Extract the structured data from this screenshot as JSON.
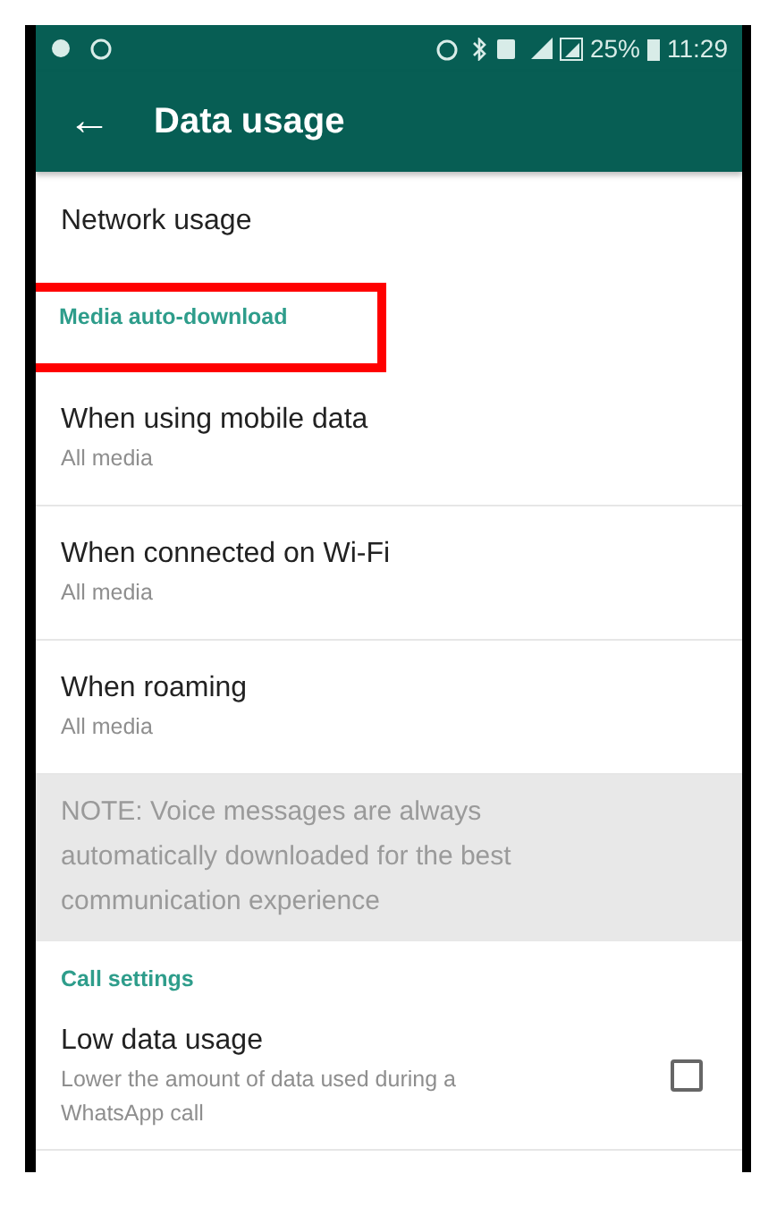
{
  "status_bar": {
    "battery": "25%",
    "time": "11:29"
  },
  "toolbar": {
    "back": "←",
    "title": "Data usage"
  },
  "items": [
    {
      "kind": "row",
      "title": "Network usage"
    },
    {
      "kind": "header",
      "title": "Media auto-download",
      "highlighted": true
    },
    {
      "kind": "row",
      "title": "When using mobile data",
      "subtitle": "All media"
    },
    {
      "kind": "row",
      "title": "When connected on Wi-Fi",
      "subtitle": "All media"
    },
    {
      "kind": "row",
      "title": "When roaming",
      "subtitle": "All media"
    },
    {
      "kind": "note",
      "title": "NOTE: Voice messages are always automatically downloaded for the best communication experience"
    },
    {
      "kind": "header",
      "title": "Call settings",
      "highlighted": false
    },
    {
      "kind": "check",
      "title": "Low data usage",
      "subtitle": "Lower the amount of data used during a WhatsApp call",
      "checked": false
    }
  ]
}
